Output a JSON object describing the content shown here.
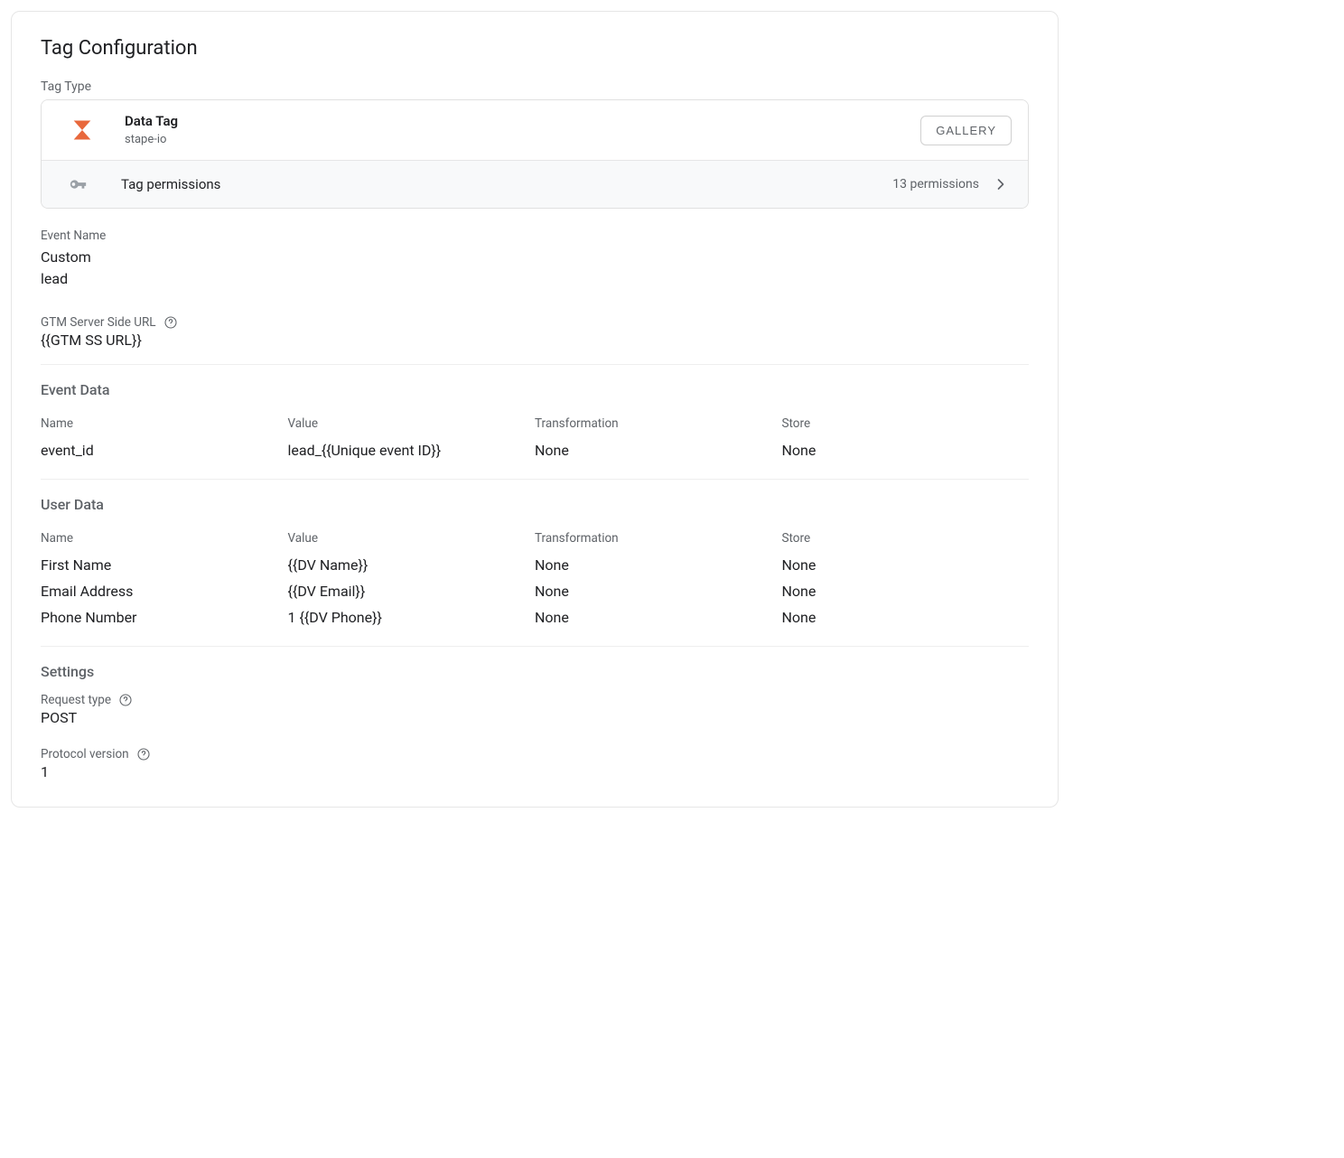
{
  "card": {
    "title": "Tag Configuration",
    "tag_type_label": "Tag Type"
  },
  "tag_type": {
    "name": "Data Tag",
    "subtitle": "stape-io",
    "gallery_label": "GALLERY",
    "permissions_label": "Tag permissions",
    "permissions_count": "13 permissions"
  },
  "event_name": {
    "label": "Event Name",
    "value1": "Custom",
    "value2": "lead"
  },
  "server_url": {
    "label": "GTM Server Side URL",
    "value": "{{GTM SS URL}}"
  },
  "event_data": {
    "title": "Event Data",
    "headers": {
      "name": "Name",
      "value": "Value",
      "transformation": "Transformation",
      "store": "Store"
    },
    "rows": [
      {
        "name": "event_id",
        "value": "lead_{{Unique event ID}}",
        "transformation": "None",
        "store": "None"
      }
    ]
  },
  "user_data": {
    "title": "User Data",
    "headers": {
      "name": "Name",
      "value": "Value",
      "transformation": "Transformation",
      "store": "Store"
    },
    "rows": [
      {
        "name": "First Name",
        "value": "{{DV Name}}",
        "transformation": "None",
        "store": "None"
      },
      {
        "name": "Email Address",
        "value": "{{DV Email}}",
        "transformation": "None",
        "store": "None"
      },
      {
        "name": "Phone Number",
        "value": "1 {{DV Phone}}",
        "transformation": "None",
        "store": "None"
      }
    ]
  },
  "settings": {
    "title": "Settings",
    "request_type": {
      "label": "Request type",
      "value": "POST"
    },
    "protocol_version": {
      "label": "Protocol version",
      "value": "1"
    }
  }
}
